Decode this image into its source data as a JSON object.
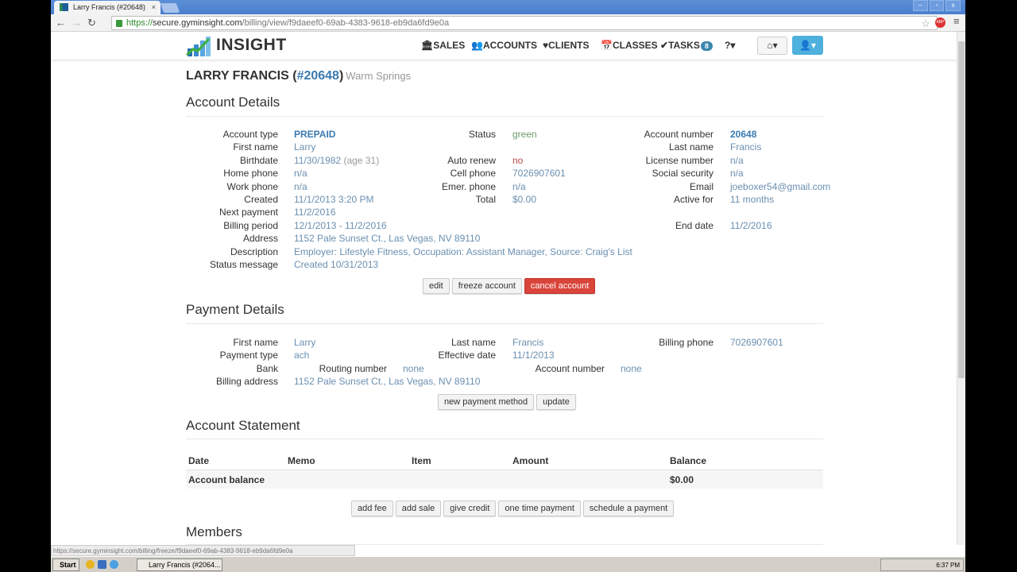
{
  "browser": {
    "tab_title": "Larry Francis (#20648)",
    "tab_close": "×",
    "url_protocol": "https://",
    "url_host": "secure.gyminsight.com",
    "url_path": "/billing/view/f9daeef0-69ab-4383-9618-eb9da6fd9e0a",
    "status_url": "https://secure.gyminsight.com/billing/freeze/f9daeef0-69ab-4383-9618-eb9da6fd9e0a",
    "adblock_label": "ABP"
  },
  "app": {
    "logo_text": "INSIGHT",
    "nav": [
      {
        "icon": "bank-icon",
        "glyph": "🏛",
        "label": "SALES"
      },
      {
        "icon": "users-icon",
        "glyph": "👥",
        "label": "ACCOUNTS"
      },
      {
        "icon": "heart-icon",
        "glyph": "♥",
        "label": "CLIENTS"
      },
      {
        "icon": "calendar-icon",
        "glyph": "📅",
        "label": "CLASSES"
      },
      {
        "icon": "check-icon",
        "glyph": "✔",
        "label": "TASKS",
        "badge": "8"
      },
      {
        "icon": "help-icon",
        "glyph": "",
        "label": "?▾"
      }
    ],
    "home_label": "⌂▾",
    "user_label": "👤▾",
    "accent": "#3a7ab0"
  },
  "header": {
    "name": "LARRY FRANCIS",
    "open": "(",
    "number": "#20648",
    "close": ")",
    "location": "Warm Springs"
  },
  "account": {
    "title": "Account Details",
    "rows": [
      [
        {
          "label": "Account type",
          "value": "PREPAID",
          "style": "strong"
        },
        {
          "label": "Status",
          "value": "green",
          "style": "green"
        },
        {
          "label": "Account number",
          "value": "20648",
          "style": "strong"
        }
      ],
      [
        {
          "label": "First name",
          "value": "Larry"
        },
        null,
        {
          "label": "Last name",
          "value": "Francis"
        }
      ],
      [
        {
          "label": "Birthdate",
          "value": "11/30/1982",
          "note": "(age 31)"
        },
        {
          "label": "Auto renew",
          "value": "no",
          "style": "red"
        },
        {
          "label": "License number",
          "value": "n/a"
        }
      ],
      [
        {
          "label": "Home phone",
          "value": "n/a"
        },
        {
          "label": "Cell phone",
          "value": "7026907601"
        },
        {
          "label": "Social security",
          "value": "n/a"
        }
      ],
      [
        {
          "label": "Work phone",
          "value": "n/a"
        },
        {
          "label": "Emer. phone",
          "value": "n/a"
        },
        {
          "label": "Email",
          "value": "joeboxer54@gmail.com"
        }
      ],
      [
        {
          "label": "Created",
          "value": "11/1/2013 3:20 PM"
        },
        {
          "label": "Total",
          "value": "$0.00"
        },
        {
          "label": "Active for",
          "value": "11 months"
        }
      ],
      [
        {
          "label": "Next payment",
          "value": "11/2/2016"
        },
        null,
        null
      ],
      [
        {
          "label": "Billing period",
          "value": "12/1/2013 - 11/2/2016"
        },
        null,
        {
          "label": "End date",
          "value": "11/2/2016"
        }
      ],
      [
        {
          "label": "Address",
          "value": "1152 Pale Sunset Ct., Las Vegas, NV 89110"
        },
        null,
        null
      ],
      [
        {
          "label": "Description",
          "value": "Employer: Lifestyle Fitness, Occupation: Assistant Manager, Source: Craig's List"
        },
        null,
        null
      ],
      [
        {
          "label": "Status message",
          "value": "Created 10/31/2013"
        },
        null,
        null
      ]
    ],
    "buttons": {
      "edit": "edit",
      "freeze": "freeze account",
      "cancel": "cancel account"
    }
  },
  "payment": {
    "title": "Payment Details",
    "rows": [
      [
        {
          "label": "First name",
          "value": "Larry"
        },
        {
          "label": "Last name",
          "value": "Francis"
        },
        {
          "label": "Billing phone",
          "value": "7026907601"
        }
      ],
      [
        {
          "label": "Payment type",
          "value": "ach"
        },
        {
          "label": "Effective date",
          "value": "11/1/2013"
        },
        null
      ]
    ],
    "bank": {
      "label": "Bank",
      "routing_label": "Routing number",
      "routing_value": "none",
      "account_label": "Account number",
      "account_value": "none"
    },
    "billing_address": {
      "label": "Billing address",
      "value": "1152 Pale Sunset Ct., Las Vegas, NV 89110"
    },
    "buttons": {
      "new_method": "new payment method",
      "update": "update"
    }
  },
  "statement": {
    "title": "Account Statement",
    "columns": [
      "Date",
      "Memo",
      "Item",
      "Amount",
      "Balance"
    ],
    "balance_label": "Account balance",
    "balance_value": "$0.00",
    "buttons": [
      "add fee",
      "add sale",
      "give credit",
      "one time payment",
      "schedule a payment"
    ]
  },
  "members": {
    "title": "Members"
  },
  "taskbar": {
    "start": "Start",
    "task": "Larry Francis (#2064...",
    "clock": "6:37 PM"
  }
}
